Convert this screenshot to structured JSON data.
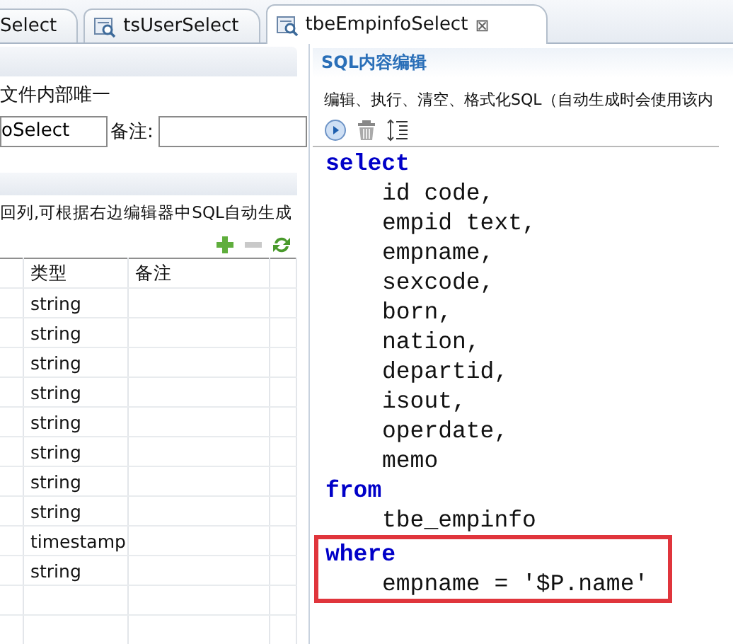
{
  "tabs": [
    {
      "label": "Select",
      "selected": false
    },
    {
      "label": "tsUserSelect",
      "selected": false
    },
    {
      "label": "tbeEmpinfoSelect",
      "selected": true,
      "close": "⊠"
    }
  ],
  "left_panel": {
    "hint": "文件内部唯一",
    "name_value": "oSelect",
    "remark_label": "备注:",
    "columns_hint": "回列,可根据右边编辑器中SQL自动生成",
    "table": {
      "columns": [
        "类型",
        "备注"
      ],
      "rows": [
        "string",
        "string",
        "string",
        "string",
        "string",
        "string",
        "string",
        "string",
        "timestamp",
        "string"
      ]
    }
  },
  "sql_editor": {
    "title": "SQL内容编辑",
    "description": "编辑、执行、清空、格式化SQL（自动生成时会使用该内",
    "lines": [
      {
        "kind": "keyword",
        "text": "select"
      },
      {
        "kind": "indented",
        "text": "id code,"
      },
      {
        "kind": "indented",
        "text": "empid text,"
      },
      {
        "kind": "indented",
        "text": "empname,"
      },
      {
        "kind": "indented",
        "text": "sexcode,"
      },
      {
        "kind": "indented",
        "text": "born,"
      },
      {
        "kind": "indented",
        "text": "nation,"
      },
      {
        "kind": "indented",
        "text": "departid,"
      },
      {
        "kind": "indented",
        "text": "isout,"
      },
      {
        "kind": "indented",
        "text": "operdate,"
      },
      {
        "kind": "indented",
        "text": "memo"
      },
      {
        "kind": "keyword",
        "text": "from"
      },
      {
        "kind": "indented",
        "text": "tbe_empinfo"
      }
    ],
    "highlighted_lines": [
      {
        "kind": "keyword",
        "text": "where"
      },
      {
        "kind": "indented",
        "text": "empname = '$P.name'"
      }
    ]
  }
}
